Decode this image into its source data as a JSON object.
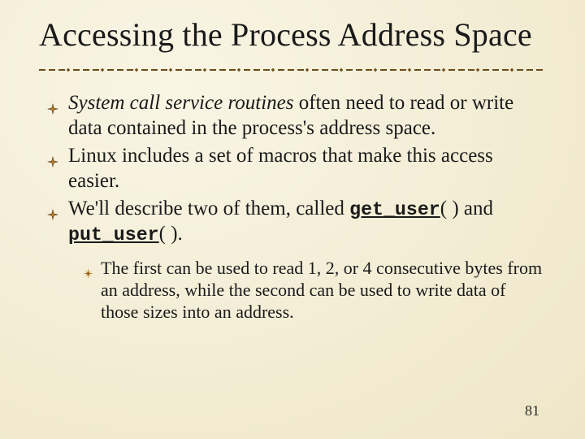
{
  "title": "Accessing the Process Address Space",
  "bullets": [
    {
      "segments": [
        {
          "text": "System call service routines",
          "style": "emph"
        },
        {
          "text": " often need to read or write data contained in the process's address space."
        }
      ]
    },
    {
      "segments": [
        {
          "text": "Linux includes a set of macros that make this access easier."
        }
      ]
    },
    {
      "segments": [
        {
          "text": "We'll describe two of them, called "
        },
        {
          "text": "get_user",
          "style": "code"
        },
        {
          "text": "( ) and "
        },
        {
          "text": "put_user",
          "style": "code"
        },
        {
          "text": "( )."
        }
      ]
    }
  ],
  "sub_bullet": "The first can be used to read 1, 2, or 4 consecutive bytes from an address, while the second can be used to write data of those sizes into an address.",
  "page_number": "81",
  "icons": {
    "level1_bullet": "compass-star-icon",
    "level2_bullet": "spark-icon"
  },
  "colors": {
    "rule": "#6b4a18",
    "bullet_dark": "#4a2f10",
    "bullet_accent": "#c0852a"
  }
}
